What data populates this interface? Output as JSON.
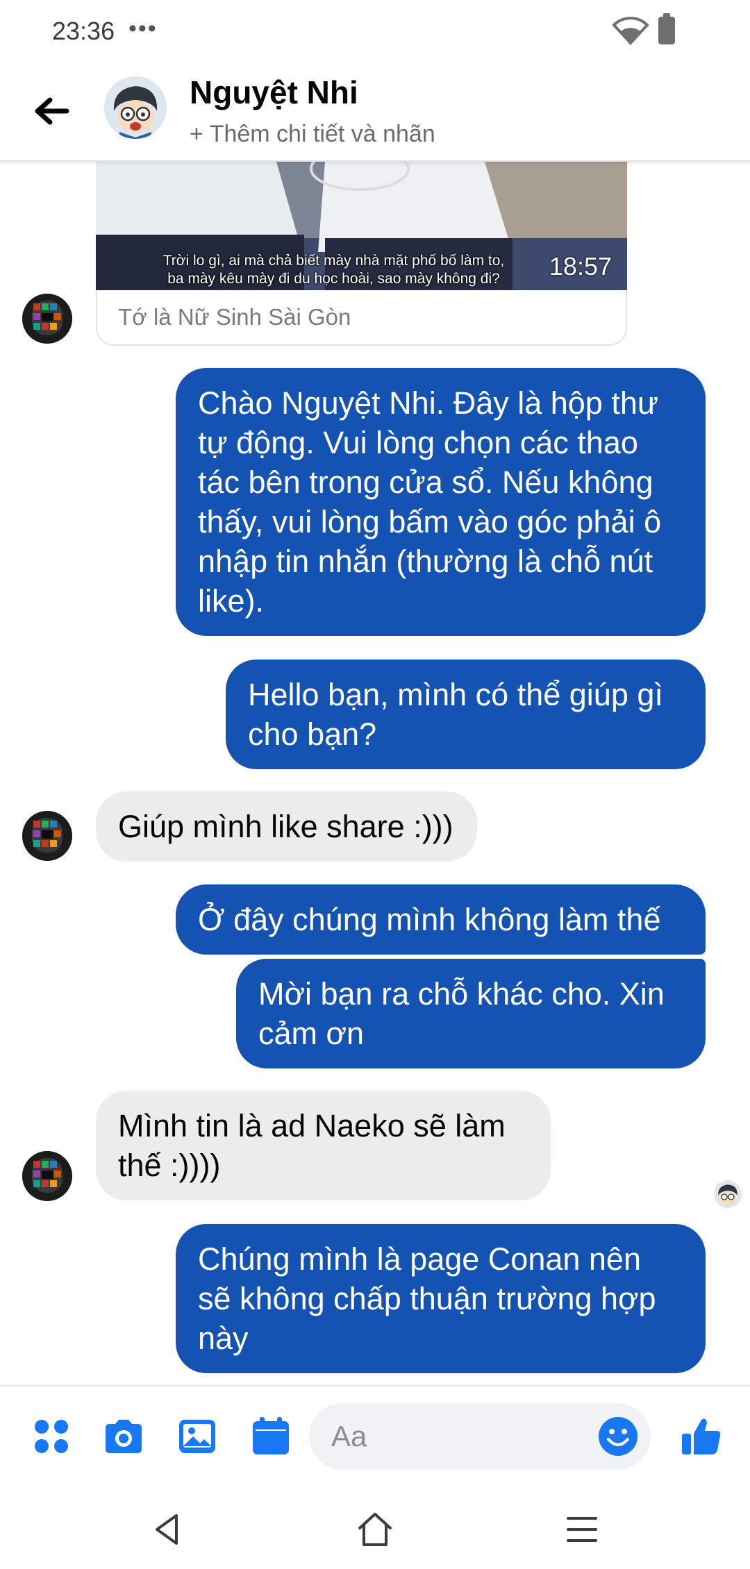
{
  "status_bar": {
    "time": "23:36",
    "more": "•••"
  },
  "header": {
    "contact_name": "Nguyệt Nhi",
    "subtitle": "+ Thêm chi tiết và nhãn"
  },
  "shared_video": {
    "caption_line1": "Trời lo gì, ai mà chả biết mày nhà mặt phố bố làm to,",
    "caption_line2": "ba mày kêu mày đi du học hoài, sao mày không đi?",
    "duration": "18:57",
    "title": "Tớ là Nữ Sinh Sài Gòn"
  },
  "messages": [
    {
      "from": "me",
      "text": "Chào Nguyệt Nhi. Đây là hộp thư tự động. Vui lòng chọn các thao tác bên trong cửa sổ. Nếu không thấy, vui lòng bấm vào góc phải ô nhập tin nhắn (thường là chỗ nút like)."
    },
    {
      "from": "me",
      "text": "Hello bạn, mình có thể giúp gì cho bạn?"
    },
    {
      "from": "them",
      "text": "Giúp mình like share :)))"
    },
    {
      "from": "me",
      "text": "Ở đây chúng mình không làm thế"
    },
    {
      "from": "me",
      "text": "Mời bạn ra chỗ khác cho. Xin cảm ơn"
    },
    {
      "from": "them",
      "text": "Mình tin là ad Naeko sẽ làm thế :))))"
    },
    {
      "from": "me",
      "text": "Chúng mình là page Conan nên sẽ không chấp thuận trường hợp này"
    }
  ],
  "composer": {
    "placeholder": "Aa"
  },
  "colors": {
    "accent": "#1877f2",
    "my_bubble": "#1453b1",
    "their_bubble": "#ececec"
  },
  "icons": {
    "status": [
      "wifi-icon",
      "battery-icon"
    ],
    "header": [
      "back-arrow-icon"
    ],
    "composer": [
      "apps-grid-icon",
      "camera-icon",
      "image-icon",
      "calendar-icon",
      "emoji-icon",
      "like-icon"
    ],
    "navigation": [
      "nav-back-icon",
      "nav-home-icon",
      "nav-menu-icon"
    ]
  }
}
